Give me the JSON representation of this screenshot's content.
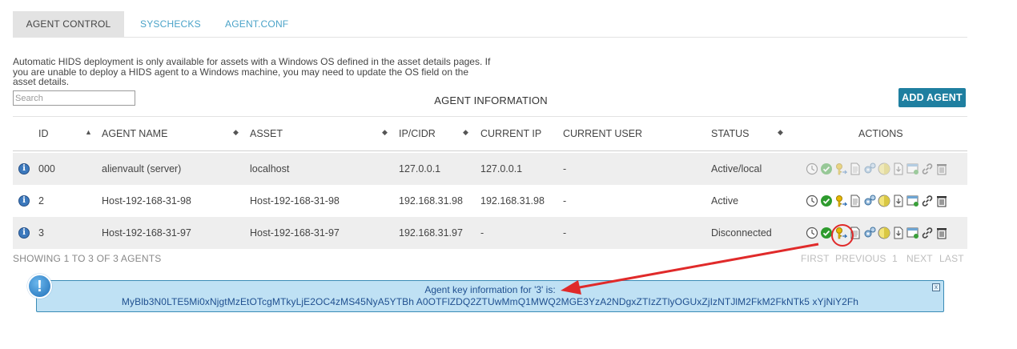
{
  "tabs": [
    {
      "label": "AGENT CONTROL"
    },
    {
      "label": "SYSCHECKS"
    },
    {
      "label": "AGENT.CONF"
    }
  ],
  "notice_text": "Automatic HIDS deployment is only available for assets with a Windows OS defined in the asset details pages. If you are unable to deploy a HIDS agent to a Windows machine, you may need to update the OS field on the asset details.",
  "search": {
    "placeholder": "Search",
    "value": ""
  },
  "table_caption": "AGENT INFORMATION",
  "add_agent_label": "ADD AGENT",
  "columns": [
    "ID",
    "AGENT NAME",
    "ASSET",
    "IP/CIDR",
    "CURRENT IP",
    "CURRENT USER",
    "STATUS",
    "ACTIONS"
  ],
  "rows": [
    {
      "id": "000",
      "name": "alienvault (server)",
      "asset": "localhost",
      "ip": "127.0.0.1",
      "current_ip": "127.0.0.1",
      "current_user": "-",
      "status": "Active/local"
    },
    {
      "id": "2",
      "name": "Host-192-168-31-98",
      "asset": "Host-192-168-31-98",
      "ip": "192.168.31.98",
      "current_ip": "192.168.31.98",
      "current_user": "-",
      "status": "Active"
    },
    {
      "id": "3",
      "name": "Host-192-168-31-97",
      "asset": "Host-192-168-31-97",
      "ip": "192.168.31.97",
      "current_ip": "-",
      "current_user": "-",
      "status": "Disconnected"
    }
  ],
  "pagination": {
    "showing": "SHOWING 1 TO 3 OF 3 AGENTS",
    "first": "FIRST",
    "previous": "PREVIOUS",
    "page": "1",
    "next": "NEXT",
    "last": "LAST"
  },
  "agent_key": {
    "title": "Agent key information for '3' is:",
    "value": "MyBlb3N0LTE5Mi0xNjgtMzEtOTcgMTkyLjE2OC4zMS45NyA5YTBh    A0OTFlZDQ2ZTUwMmQ1MWQ2MGE3YzA2NDgxZTIzZTlyOGUxZjIzNTJlM2FkM2FkNTk5    xYjNiY2Fh",
    "close": "x"
  },
  "icons": {
    "info": "info-icon",
    "actions": [
      "clock-icon",
      "check-icon",
      "key-icon",
      "document-icon",
      "gears-icon",
      "circle-icon",
      "download-icon",
      "window-icon",
      "link-icon",
      "trash-icon"
    ],
    "alert": "alert-icon"
  },
  "colors": {
    "accent": "#1f7fa0",
    "tab_link": "#4ba3c8",
    "highlight": "#e02a2a",
    "info_box": "#bfe1f4"
  }
}
